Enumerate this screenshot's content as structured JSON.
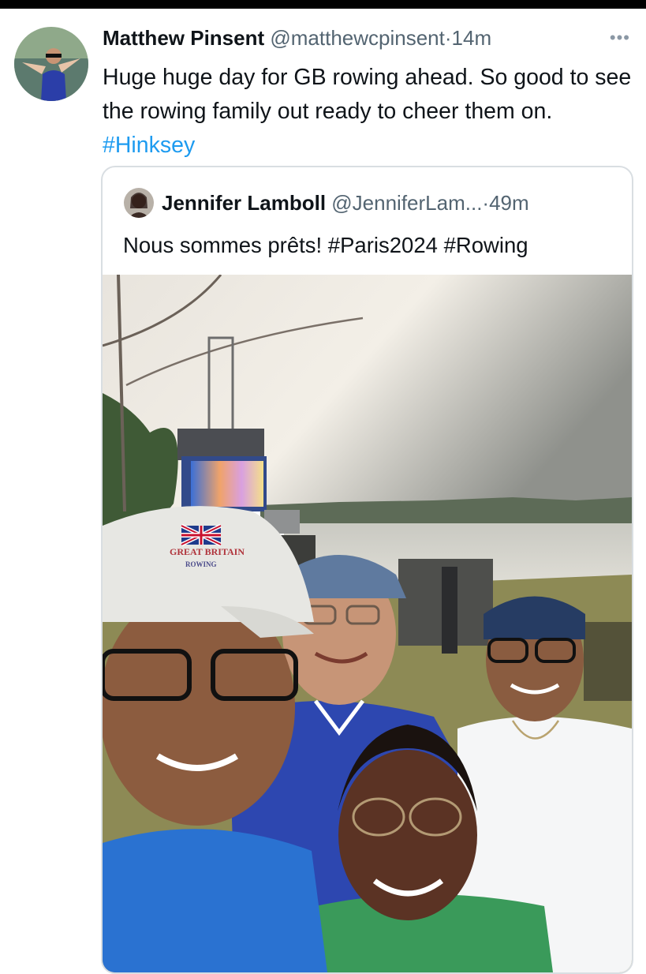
{
  "post": {
    "author_name": "Matthew Pinsent",
    "handle": "@matthewcpinsent",
    "separator": "·",
    "timestamp": "14m",
    "more_icon": "more-horizontal-icon",
    "text": "Huge huge day for GB rowing ahead. So good to see the rowing family out ready to cheer them on.",
    "hashtag": "#Hinksey"
  },
  "quote": {
    "author_name": "Jennifer Lamboll",
    "handle": "@JenniferLam...",
    "separator": "·",
    "timestamp": "49m",
    "text": "Nous sommes prêts! #Paris2024 #Rowing"
  },
  "photo": {
    "cap_text_line1": "GREAT BRITAIN",
    "cap_text_line2": "ROWING"
  },
  "colors": {
    "link": "#1d9bf0",
    "secondary_text": "#536471",
    "border": "#d9dee2",
    "top_bar": "#000000"
  }
}
